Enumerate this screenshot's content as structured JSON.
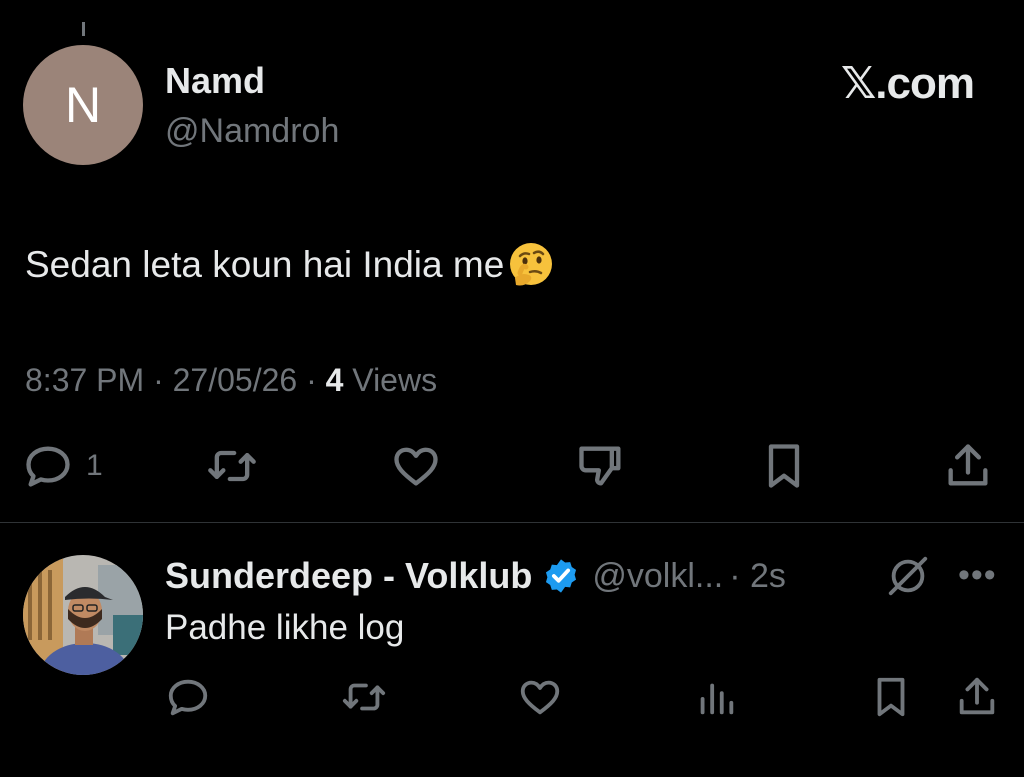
{
  "tweet": {
    "avatar_letter": "N",
    "avatar_color": "#9b8479",
    "author_name": "Namd",
    "author_handle": "@Namdroh",
    "brand": "𝕏.com",
    "text": "Sedan leta koun hai India me",
    "emoji": "thinking-face",
    "time": "8:37 PM",
    "date": "27/05/26",
    "views_count": "4",
    "views_label": "Views",
    "reply_count": "1"
  },
  "reply": {
    "author_name": "Sunderdeep - Volklub",
    "author_handle": "@volkl...",
    "time": "· 2s",
    "text": "Padhe likhe log",
    "verified_color": "#1d9bf0"
  },
  "icons": [
    "reply-icon",
    "retweet-icon",
    "like-icon",
    "dislike-icon",
    "bookmark-icon",
    "share-icon",
    "analytics-icon",
    "grok-icon",
    "more-icon",
    "verified-badge-icon"
  ]
}
